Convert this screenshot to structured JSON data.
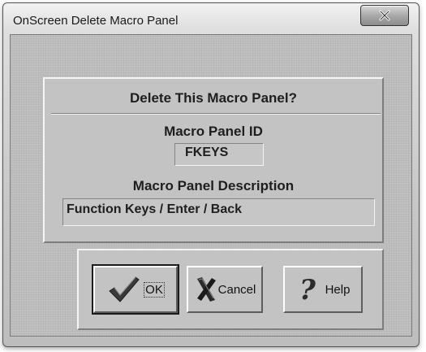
{
  "window": {
    "title": "OnScreen Delete Macro Panel",
    "close_icon": "close-x-icon"
  },
  "dialog": {
    "heading": "Delete This Macro Panel?",
    "id_label": "Macro Panel ID",
    "id_value": "FKEYS",
    "description_label": "Macro Panel Description",
    "description_value": "Function Keys / Enter / Back"
  },
  "buttons": {
    "ok": {
      "label": "OK",
      "icon": "checkmark-icon"
    },
    "cancel": {
      "label": "Cancel",
      "icon": "x-mark-icon"
    },
    "help": {
      "label": "Help",
      "icon": "question-mark-icon"
    }
  },
  "colors": {
    "face": "#c0c0c0",
    "text": "#1e1e1e"
  }
}
